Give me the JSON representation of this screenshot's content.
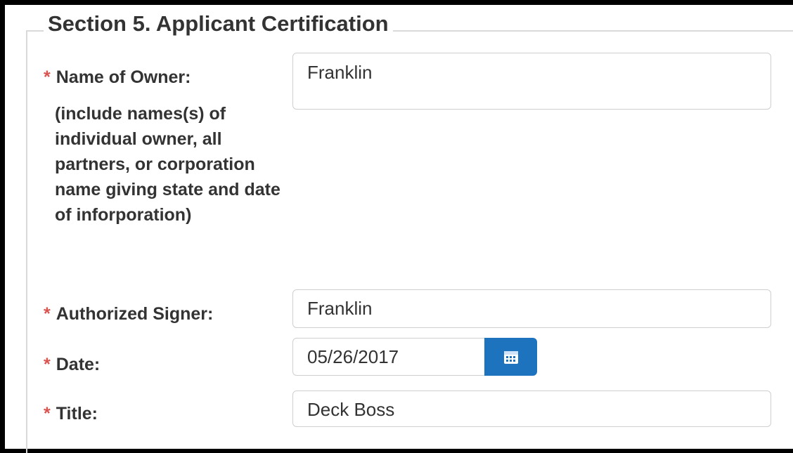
{
  "section": {
    "legend": "Section 5. Applicant Certification"
  },
  "fields": {
    "required_marker": "*",
    "owner": {
      "label": "Name of Owner:",
      "note": "(include names(s) of individual owner, all partners, or corporation name giving state and date of inforporation)",
      "value": "Franklin"
    },
    "signer": {
      "label": "Authorized Signer:",
      "value": "Franklin"
    },
    "date": {
      "label": "Date:",
      "value": "05/26/2017",
      "button_icon": "calendar-icon"
    },
    "title": {
      "label": "Title:",
      "value": "Deck Boss"
    }
  },
  "colors": {
    "required": "#d9534f",
    "button": "#1e73be",
    "border": "#cfcfcf",
    "text": "#333333"
  }
}
